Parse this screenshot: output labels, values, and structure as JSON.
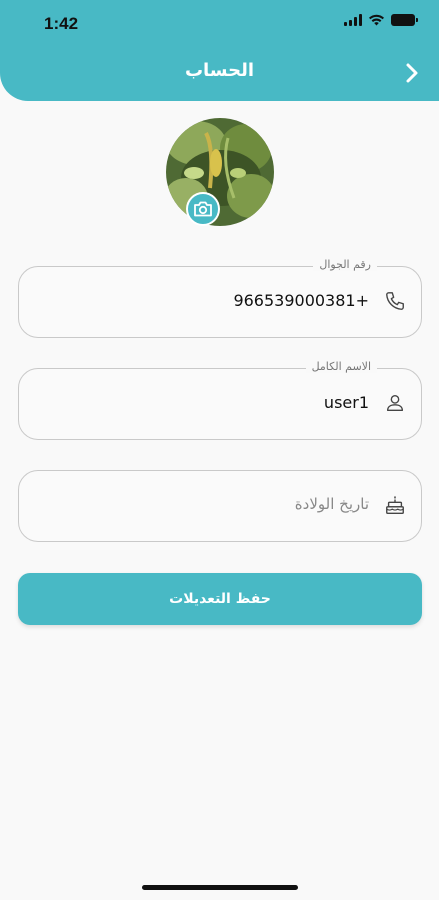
{
  "status_bar": {
    "time": "1:42"
  },
  "header": {
    "title": "الحساب",
    "back_icon": "chevron-right-icon",
    "background_color": "#48b9c5"
  },
  "profile": {
    "avatar_icon": "profile-photo",
    "camera_icon": "camera-icon"
  },
  "form": {
    "phone": {
      "label": "رقم الجوال",
      "value": "966539000381+",
      "icon": "phone-icon"
    },
    "full_name": {
      "label": "الاسم الكامل",
      "value": "user1",
      "icon": "user-icon"
    },
    "birth_date": {
      "placeholder": "تاريخ الولادة",
      "icon": "birthday-cake-icon"
    },
    "save_label": "حفظ التعديلات"
  },
  "colors": {
    "accent": "#48b9c5",
    "field_border": "#c9c9c9"
  }
}
